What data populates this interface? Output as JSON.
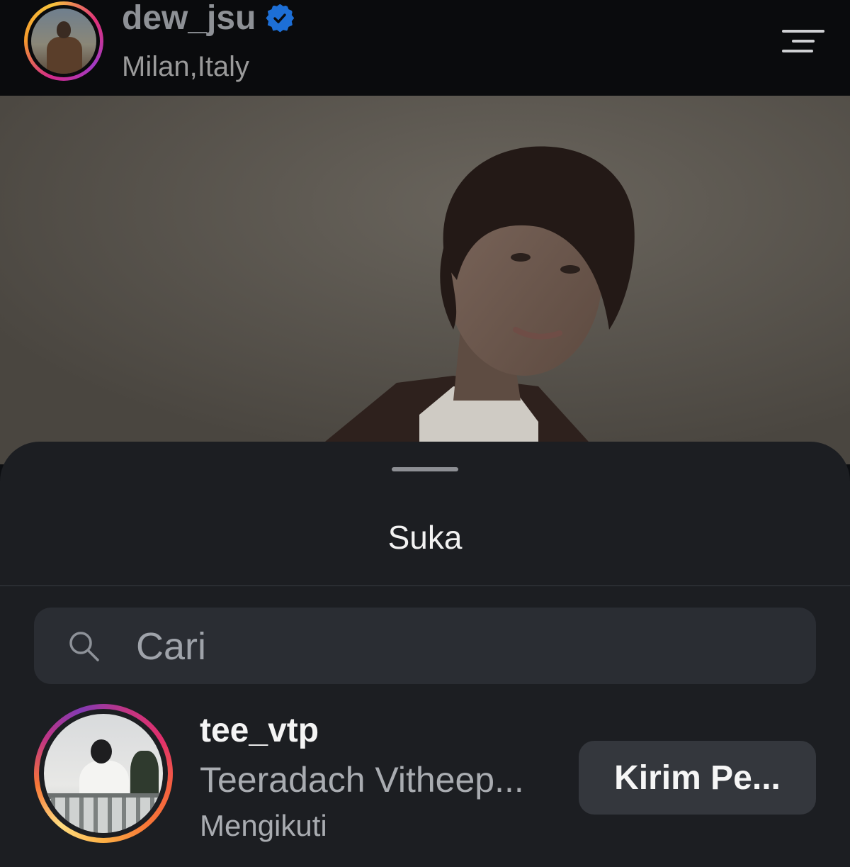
{
  "header": {
    "username": "dew_jsu",
    "location": "Milan,Italy",
    "verified_icon": "verified-badge-icon",
    "menu_icon": "hamburger-menu-icon"
  },
  "sheet": {
    "title": "Suka",
    "search_placeholder": "Cari",
    "likes": [
      {
        "username": "tee_vtp",
        "full_name": "Teeradach Vitheep...",
        "status": "Mengikuti",
        "action_label": "Kirim Pe..."
      }
    ]
  },
  "colors": {
    "background": "#0d0f12",
    "sheet": "#1c1e22",
    "search_field": "#2a2d33",
    "button": "#34373d",
    "verified": "#1d6fd6"
  }
}
